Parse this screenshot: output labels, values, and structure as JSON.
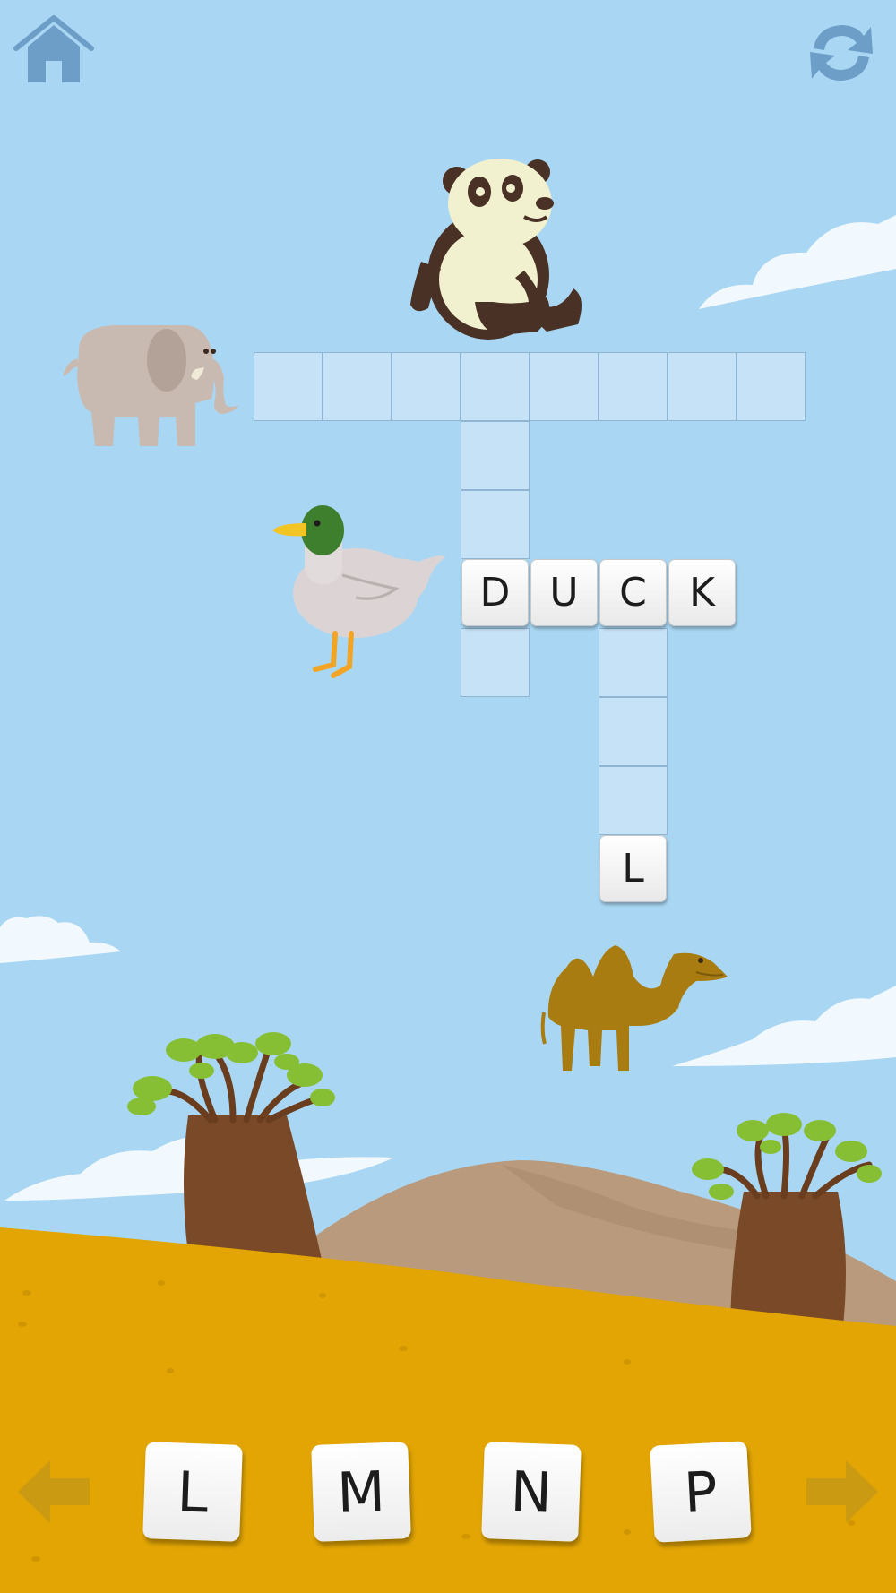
{
  "colors": {
    "sky": "#a9d7f3",
    "sand": "#e2a504",
    "hills": "#b99a7c",
    "tree_trunk": "#7a4a28",
    "leaves": "#86bf34",
    "grid_cell": "#c6e2f6",
    "nav_arrow": "#c99a12",
    "corner_icon": "#6d9ec7"
  },
  "toolbar": {
    "home_icon": "home-icon",
    "refresh_icon": "refresh-icon"
  },
  "animals": [
    "panda",
    "elephant",
    "duck",
    "camel"
  ],
  "crossword": {
    "duck_word": [
      "D",
      "U",
      "C",
      "K"
    ],
    "camel_last_letter": "L"
  },
  "letter_choices": [
    "L",
    "M",
    "N",
    "P"
  ],
  "nav": {
    "prev_icon": "arrow-left-icon",
    "next_icon": "arrow-right-icon"
  }
}
